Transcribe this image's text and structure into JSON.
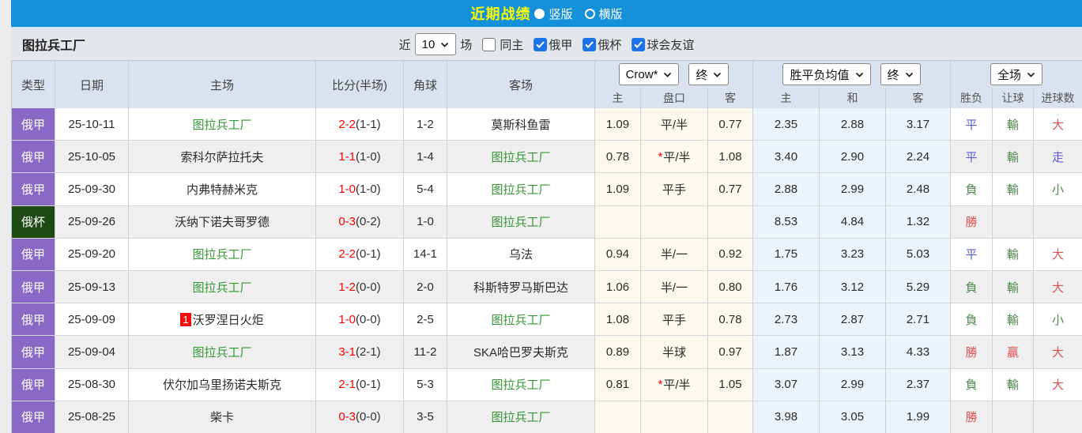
{
  "topbar": {
    "title": "近期战绩",
    "vertical_label": "竖版",
    "horizontal_label": "横版",
    "vertical_checked": true,
    "horizontal_checked": false
  },
  "filterbar": {
    "team_name": "图拉兵工厂",
    "near_label": "近",
    "count_value": "10",
    "matches_label": "场",
    "same_home": {
      "label": "同主",
      "checked": false
    },
    "league_filters": [
      {
        "label": "俄甲",
        "checked": true
      },
      {
        "label": "俄杯",
        "checked": true
      },
      {
        "label": "球会友谊",
        "checked": true
      }
    ]
  },
  "table": {
    "selectors": {
      "bookmaker": "Crow*",
      "bookmaker_stage": "终",
      "europe": "胜平负均值",
      "europe_stage": "终",
      "scope": "全场"
    },
    "columns": [
      "类型",
      "日期",
      "主场",
      "比分(半场)",
      "角球",
      "客场"
    ],
    "sub_columns": [
      "主",
      "盘口",
      "客",
      "主",
      "和",
      "客",
      "胜负",
      "让球",
      "进球数"
    ],
    "colors": {
      "topbar_blue": "#1591d9",
      "title_yellow": "#ffff00",
      "badge_purple": "#8a68c6",
      "badge_dark_green": "#1d4a12",
      "team_green": "#339933",
      "score_red": "#ff0000",
      "win_red": "#e05252",
      "lose_green": "#4f8a4f",
      "draw_blue": "#5c5cd6",
      "handicap_bg": "#fcf8ee",
      "europe_bg": "#eaf4fa"
    },
    "rows": [
      {
        "league": "俄甲",
        "league_color": "purple",
        "date": "25-10-11",
        "home": "图拉兵工厂",
        "home_team": true,
        "home_rank": "",
        "score": "2-2",
        "half": "(1-1)",
        "corner": "1-2",
        "away": "莫斯科鱼雷",
        "away_team": false,
        "ah_star": false,
        "ah_home": "1.09",
        "handicap": "平/半",
        "ah_away": "0.77",
        "eu_home": "2.35",
        "eu_draw": "2.88",
        "eu_away": "3.17",
        "result": "平",
        "result_c": "blue",
        "let_ball": "輸",
        "let_c": "green",
        "goals": "大",
        "goals_c": "red"
      },
      {
        "league": "俄甲",
        "league_color": "purple",
        "date": "25-10-05",
        "home": "索科尔萨拉托夫",
        "home_team": false,
        "home_rank": "",
        "score": "1-1",
        "half": "(1-0)",
        "corner": "1-4",
        "away": "图拉兵工厂",
        "away_team": true,
        "ah_star": true,
        "ah_home": "0.78",
        "handicap": "平/半",
        "ah_away": "1.08",
        "eu_home": "3.40",
        "eu_draw": "2.90",
        "eu_away": "2.24",
        "result": "平",
        "result_c": "blue",
        "let_ball": "輸",
        "let_c": "green",
        "goals": "走",
        "goals_c": "blue"
      },
      {
        "league": "俄甲",
        "league_color": "purple",
        "date": "25-09-30",
        "home": "内弗特赫米克",
        "home_team": false,
        "home_rank": "",
        "score": "1-0",
        "half": "(1-0)",
        "corner": "5-4",
        "away": "图拉兵工厂",
        "away_team": true,
        "ah_star": false,
        "ah_home": "1.09",
        "handicap": "平手",
        "ah_away": "0.77",
        "eu_home": "2.88",
        "eu_draw": "2.99",
        "eu_away": "2.48",
        "result": "負",
        "result_c": "green",
        "let_ball": "輸",
        "let_c": "green",
        "goals": "小",
        "goals_c": "green"
      },
      {
        "league": "俄杯",
        "league_color": "green",
        "date": "25-09-26",
        "home": "沃纳下诺夫哥罗德",
        "home_team": false,
        "home_rank": "",
        "score": "0-3",
        "half": "(0-2)",
        "corner": "1-0",
        "away": "图拉兵工厂",
        "away_team": true,
        "ah_star": false,
        "ah_home": "",
        "handicap": "",
        "ah_away": "",
        "eu_home": "8.53",
        "eu_draw": "4.84",
        "eu_away": "1.32",
        "result": "勝",
        "result_c": "red",
        "let_ball": "",
        "let_c": "",
        "goals": "",
        "goals_c": ""
      },
      {
        "league": "俄甲",
        "league_color": "purple",
        "date": "25-09-20",
        "home": "图拉兵工厂",
        "home_team": true,
        "home_rank": "",
        "score": "2-2",
        "half": "(0-1)",
        "corner": "14-1",
        "away": "乌法",
        "away_team": false,
        "ah_star": false,
        "ah_home": "0.94",
        "handicap": "半/一",
        "ah_away": "0.92",
        "eu_home": "1.75",
        "eu_draw": "3.23",
        "eu_away": "5.03",
        "result": "平",
        "result_c": "blue",
        "let_ball": "輸",
        "let_c": "green",
        "goals": "大",
        "goals_c": "red"
      },
      {
        "league": "俄甲",
        "league_color": "purple",
        "date": "25-09-13",
        "home": "图拉兵工厂",
        "home_team": true,
        "home_rank": "",
        "score": "1-2",
        "half": "(0-0)",
        "corner": "2-0",
        "away": "科斯特罗马斯巴达",
        "away_team": false,
        "ah_star": false,
        "ah_home": "1.06",
        "handicap": "半/一",
        "ah_away": "0.80",
        "eu_home": "1.76",
        "eu_draw": "3.12",
        "eu_away": "5.29",
        "result": "負",
        "result_c": "green",
        "let_ball": "輸",
        "let_c": "green",
        "goals": "大",
        "goals_c": "red"
      },
      {
        "league": "俄甲",
        "league_color": "purple",
        "date": "25-09-09",
        "home": "沃罗涅日火炬",
        "home_team": false,
        "home_rank": "1",
        "score": "1-0",
        "half": "(0-0)",
        "corner": "2-5",
        "away": "图拉兵工厂",
        "away_team": true,
        "ah_star": false,
        "ah_home": "1.08",
        "handicap": "平手",
        "ah_away": "0.78",
        "eu_home": "2.73",
        "eu_draw": "2.87",
        "eu_away": "2.71",
        "result": "負",
        "result_c": "green",
        "let_ball": "輸",
        "let_c": "green",
        "goals": "小",
        "goals_c": "green"
      },
      {
        "league": "俄甲",
        "league_color": "purple",
        "date": "25-09-04",
        "home": "图拉兵工厂",
        "home_team": true,
        "home_rank": "",
        "score": "3-1",
        "half": "(2-1)",
        "corner": "11-2",
        "away": "SKA哈巴罗夫斯克",
        "away_team": false,
        "ah_star": false,
        "ah_home": "0.89",
        "handicap": "半球",
        "ah_away": "0.97",
        "eu_home": "1.87",
        "eu_draw": "3.13",
        "eu_away": "4.33",
        "result": "勝",
        "result_c": "red",
        "let_ball": "贏",
        "let_c": "red",
        "goals": "大",
        "goals_c": "red"
      },
      {
        "league": "俄甲",
        "league_color": "purple",
        "date": "25-08-30",
        "home": "伏尔加乌里扬诺夫斯克",
        "home_team": false,
        "home_rank": "",
        "score": "2-1",
        "half": "(0-1)",
        "corner": "5-3",
        "away": "图拉兵工厂",
        "away_team": true,
        "ah_star": true,
        "ah_home": "0.81",
        "handicap": "平/半",
        "ah_away": "1.05",
        "eu_home": "3.07",
        "eu_draw": "2.99",
        "eu_away": "2.37",
        "result": "負",
        "result_c": "green",
        "let_ball": "輸",
        "let_c": "green",
        "goals": "大",
        "goals_c": "red"
      },
      {
        "league": "俄甲",
        "league_color": "purple",
        "date": "25-08-25",
        "home": "柴卡",
        "home_team": false,
        "home_rank": "",
        "score": "0-3",
        "half": "(0-0)",
        "corner": "3-5",
        "away": "图拉兵工厂",
        "away_team": true,
        "ah_star": false,
        "ah_home": "",
        "handicap": "",
        "ah_away": "",
        "eu_home": "3.98",
        "eu_draw": "3.05",
        "eu_away": "1.99",
        "result": "勝",
        "result_c": "red",
        "let_ball": "",
        "let_c": "",
        "goals": "",
        "goals_c": ""
      }
    ]
  }
}
